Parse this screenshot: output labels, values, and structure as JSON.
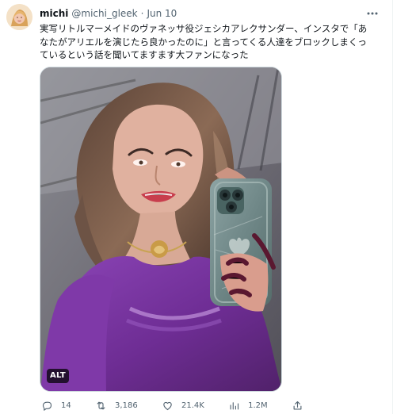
{
  "tweet": {
    "author": {
      "display_name": "michi",
      "handle": "@michi_gleek",
      "separator": "·",
      "date": "Jun 10"
    },
    "text": "実写リトルマーメイドのヴァネッサ役ジェシカアレクサンダー、インスタで「あなたがアリエルを演じたら良かったのに」と言ってくる人達をブロックしまくっているという話を聞いてますます大ファンになった",
    "media": {
      "alt_badge": "ALT"
    },
    "actions": {
      "replies": "14",
      "retweets": "3,186",
      "likes": "21.4K",
      "views": "1.2M"
    }
  },
  "icons": {
    "more": "more-horizontal-icon",
    "reply": "reply-icon",
    "retweet": "retweet-icon",
    "like": "heart-icon",
    "views": "analytics-icon",
    "share": "share-icon"
  },
  "colors": {
    "text": "#0f1419",
    "secondary": "#536471",
    "border": "#cfd9de"
  }
}
